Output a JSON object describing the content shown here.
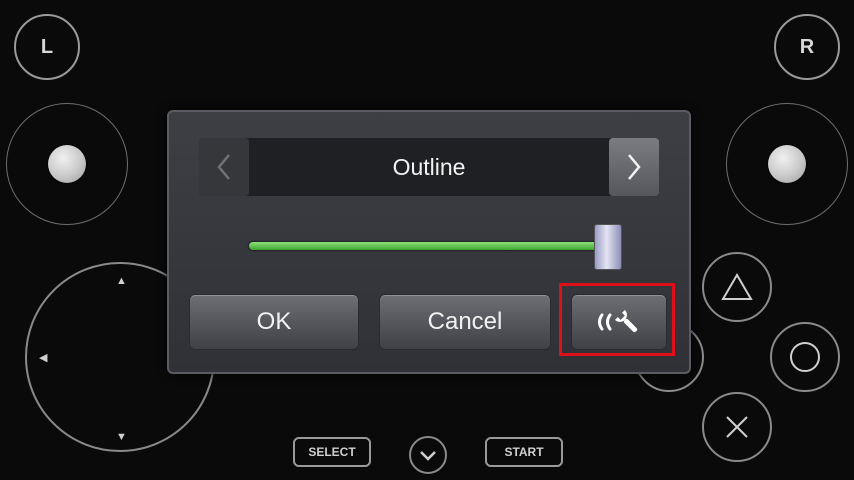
{
  "controller": {
    "left_shoulder": "L",
    "right_shoulder": "R",
    "select_label": "SELECT",
    "start_label": "START"
  },
  "dialog": {
    "option_label": "Outline",
    "slider_value_percent": 97,
    "ok_label": "OK",
    "cancel_label": "Cancel",
    "tools_icon": "touch-wrench-icon"
  },
  "colors": {
    "slider_green": "#3fa52f",
    "highlight_red": "#e0101a"
  }
}
